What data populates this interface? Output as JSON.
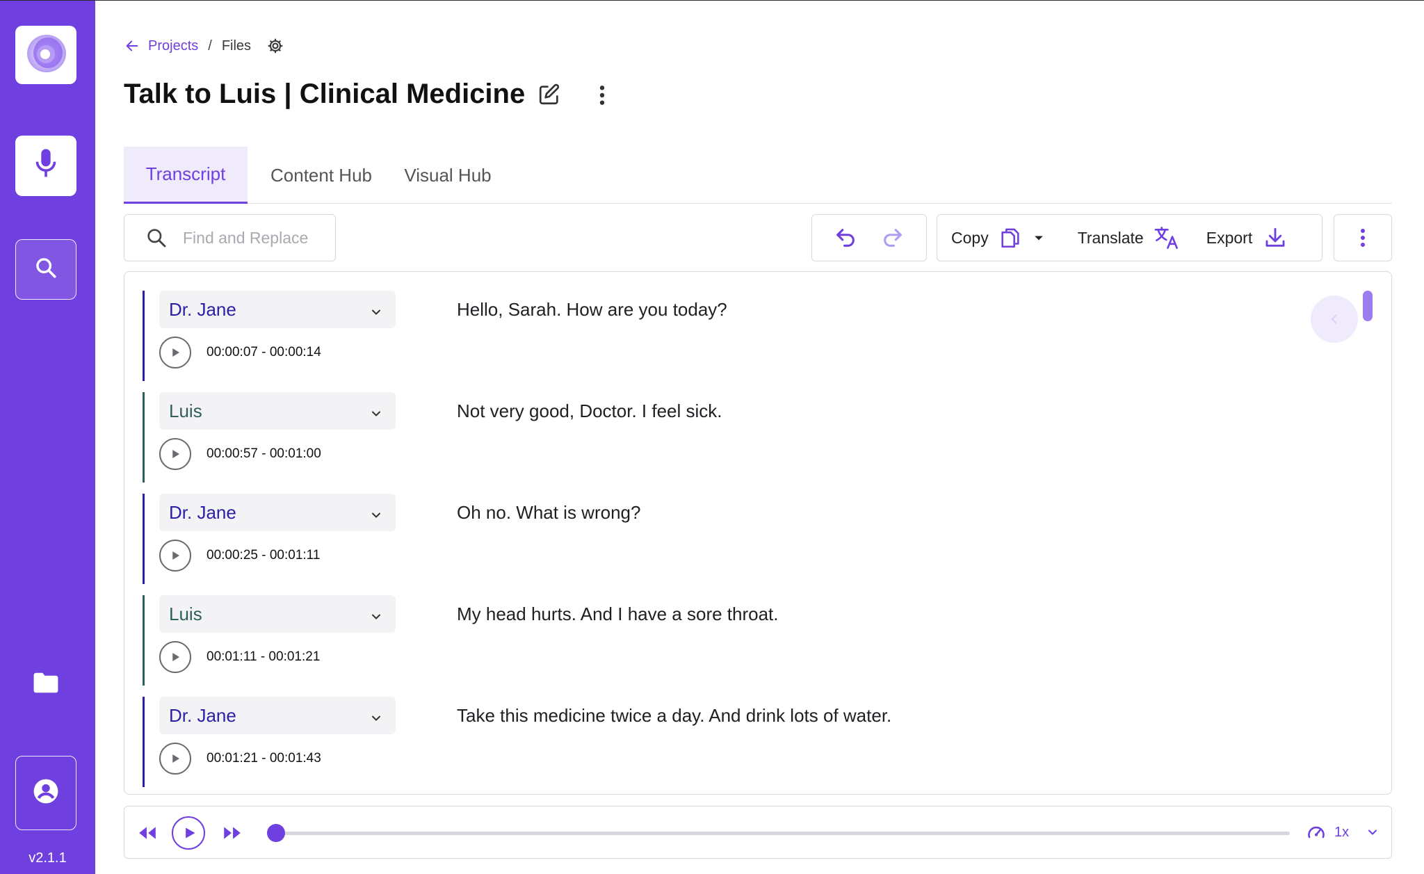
{
  "app": {
    "version": "v2.1.1",
    "accent_color": "#6f3fe0",
    "sidebar": [
      {
        "icon": "app-logo-icon"
      },
      {
        "icon": "microphone-icon"
      },
      {
        "icon": "search-icon"
      },
      {
        "icon": "folder-icon"
      },
      {
        "icon": "account-circle-icon"
      }
    ]
  },
  "breadcrumb": {
    "back_icon": "arrow-left-icon",
    "projects": "Projects",
    "separator": "/",
    "files": "Files",
    "settings_icon": "gear-icon"
  },
  "page": {
    "title": "Talk to Luis | Clinical Medicine",
    "edit_icon": "edit-icon",
    "more_icon": "more-vertical-icon"
  },
  "tabs": [
    {
      "label": "Transcript",
      "active": true
    },
    {
      "label": "Content Hub",
      "active": false
    },
    {
      "label": "Visual Hub",
      "active": false
    }
  ],
  "toolbar": {
    "search_placeholder": "Find and Replace",
    "undo_icon": "undo-icon",
    "redo_icon": "redo-icon",
    "copy_label": "Copy",
    "copy_icon": "copy-icon",
    "copy_dropdown_icon": "caret-down-icon",
    "translate_label": "Translate",
    "translate_icon": "translate-icon",
    "export_label": "Export",
    "export_icon": "download-icon",
    "more_icon": "more-vertical-icon"
  },
  "transcript": {
    "speaker_colors": {
      "Dr. Jane": "#2b1fa8",
      "Luis": "#2f5f5c"
    },
    "segments": [
      {
        "speaker": "Dr. Jane",
        "time": "00:00:07 - 00:00:14",
        "text": "Hello, Sarah. How are you today?"
      },
      {
        "speaker": "Luis",
        "time": "00:00:57 - 00:01:00",
        "text": "Not very good, Doctor. I feel sick."
      },
      {
        "speaker": "Dr. Jane",
        "time": "00:00:25 - 00:01:11",
        "text": "Oh no. What is wrong?"
      },
      {
        "speaker": "Luis",
        "time": "00:01:11 - 00:01:21",
        "text": "My head hurts. And I have a sore throat."
      },
      {
        "speaker": "Dr. Jane",
        "time": "00:01:21 - 00:01:43",
        "text": "Take this medicine twice a day. And drink lots of water."
      }
    ]
  },
  "player": {
    "rewind_icon": "rewind-icon",
    "play_icon": "play-icon",
    "forward_icon": "fast-forward-icon",
    "progress": 0,
    "speed_icon": "speedometer-icon",
    "speed": "1x",
    "speed_dropdown_icon": "chevron-down-icon"
  }
}
